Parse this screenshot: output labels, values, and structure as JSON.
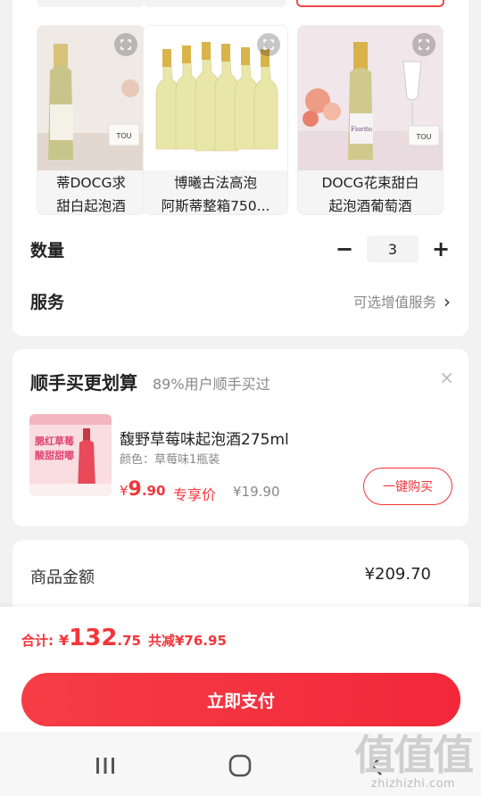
{
  "product_options": [
    {
      "line1": "蒂DOCG求",
      "line2": "甜白起泡酒",
      "zoom_icon": "expand-icon"
    },
    {
      "line1": "博曦古法高泡",
      "line2": "阿斯蒂整箱750...",
      "zoom_icon": "expand-icon"
    },
    {
      "line1": "DOCG花束甜白",
      "line2": "起泡酒葡萄酒",
      "zoom_icon": "expand-icon"
    }
  ],
  "bottle_labels": {
    "tou_1": "TOU",
    "tou_3": "TOU",
    "brand_3": "Fiorito"
  },
  "quantity": {
    "label": "数量",
    "value": "3",
    "minus": "−",
    "plus": "+"
  },
  "service": {
    "label": "服务",
    "value": "可选增值服务",
    "chevron": "›"
  },
  "addon": {
    "title": "顺手买更划算",
    "subtitle": "89%用户顺手买过",
    "close": "×",
    "thumb_text_line1": "腮红草莓",
    "thumb_text_line2": "酸甜甜嘟",
    "name": "馥野草莓味起泡酒275ml",
    "spec": "颜色：草莓味1瓶装",
    "price_currency": "¥",
    "price_int": "9",
    "price_dec": ".90",
    "price_tag": "专享价",
    "original_price": "¥19.90",
    "buy_button": "一键购买"
  },
  "summary": {
    "label": "商品金额",
    "value": "¥209.70"
  },
  "checkout": {
    "total_label": "合计:",
    "currency": "¥",
    "total_int": "132",
    "total_dec": ".75",
    "discount": "共减¥76.95",
    "pay_button": "立即支付"
  },
  "watermark": {
    "big": "值值值",
    "small": "zhizhizhi.com"
  },
  "colors": {
    "accent": "#f4353a",
    "background": "#f2f2f2",
    "card": "#ffffff"
  }
}
